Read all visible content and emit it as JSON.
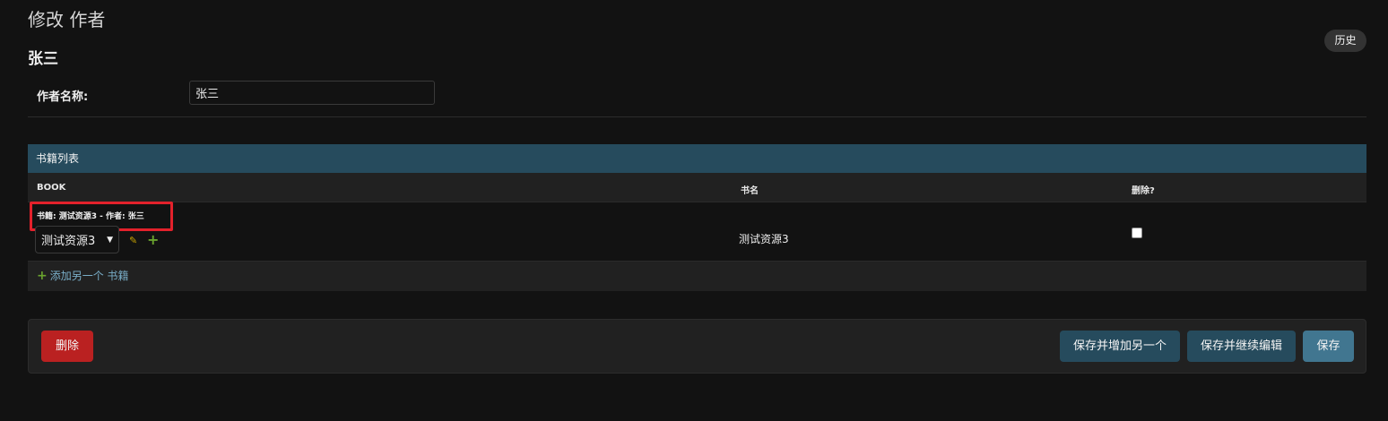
{
  "page": {
    "heading": "修改 作者",
    "history_label": "历史",
    "object_title": "张三"
  },
  "form": {
    "name_label": "作者名称:",
    "name_value": "张三"
  },
  "inline": {
    "caption": "书籍列表",
    "columns": [
      "BOOK",
      "书名",
      "删除?"
    ],
    "rows": [
      {
        "original": "书籍: 测试资源3 - 作者: 张三",
        "book_selected": "测试资源3",
        "title": "测试资源3",
        "delete_checked": false
      }
    ],
    "add_another_label": "添加另一个 书籍"
  },
  "actions": {
    "delete_label": "删除",
    "save_add_label": "保存并增加另一个",
    "save_continue_label": "保存并继续编辑",
    "save_label": "保存"
  },
  "colors": {
    "background": "#121212",
    "caption": "#264b5d",
    "primary_button": "#417690",
    "delete_button": "#ba2121",
    "highlight": "#e3212b",
    "link": "#79aec8",
    "add_icon": "#6aa32e",
    "edit_icon": "#c9a400"
  },
  "icons": {
    "edit": "pencil-icon",
    "add": "plus-icon",
    "select": "chevron-down-icon"
  }
}
